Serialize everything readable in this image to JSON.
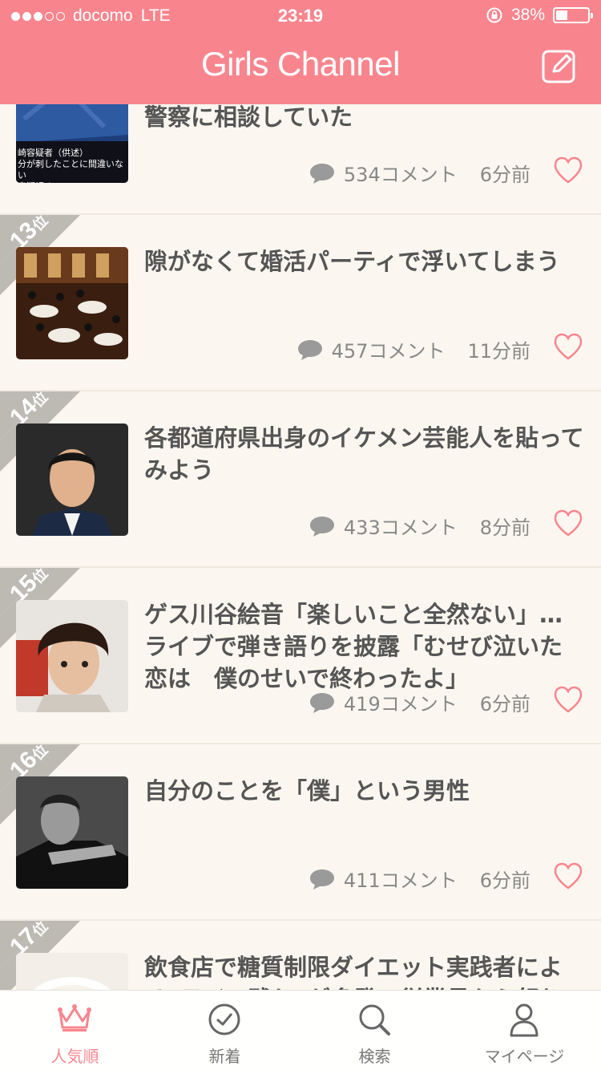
{
  "status_bar": {
    "carrier": "docomo",
    "network": "LTE",
    "time": "23:19",
    "battery": "38%",
    "battery_level": 0.38
  },
  "header": {
    "title": "Girls Channel"
  },
  "items": [
    {
      "rank": "",
      "title": "ト返され憤慨、駅で待ち伏せ　被害者は警察に相談していた",
      "comments": "534コメント",
      "time": "6分前",
      "thumb_caption": "崎容疑者（供述）\n分が刺したことに間違いない\n容疑認め"
    },
    {
      "rank": "13",
      "rank_suffix": "位",
      "title": "隙がなくて婚活パーティで浮いてしまう",
      "comments": "457コメント",
      "time": "11分前"
    },
    {
      "rank": "14",
      "rank_suffix": "位",
      "title": "各都道府県出身のイケメン芸能人を貼ってみよう",
      "comments": "433コメント",
      "time": "8分前"
    },
    {
      "rank": "15",
      "rank_suffix": "位",
      "title": "ゲス川谷絵音「楽しいこと全然ない」…ライブで弾き語りを披露「むせび泣いた恋は　僕のせいで終わったよ」",
      "comments": "419コメント",
      "time": "6分前"
    },
    {
      "rank": "16",
      "rank_suffix": "位",
      "title": "自分のことを「僕」という男性",
      "comments": "411コメント",
      "time": "6分前"
    },
    {
      "rank": "17",
      "rank_suffix": "位",
      "title": "飲食店で糖質制限ダイエット実践者による\"ライス残し\"が多発…従業員から怒りと困惑の声",
      "comments": "",
      "time": ""
    }
  ],
  "tabs": [
    {
      "label": "人気順",
      "icon": "crown-icon",
      "active": true
    },
    {
      "label": "新着",
      "icon": "clock-icon",
      "active": false
    },
    {
      "label": "検索",
      "icon": "search-icon",
      "active": false
    },
    {
      "label": "マイページ",
      "icon": "person-icon",
      "active": false
    }
  ],
  "colors": {
    "accent": "#f8858e",
    "background": "#fbf7f0",
    "rank_ribbon": "#bdbab4"
  }
}
